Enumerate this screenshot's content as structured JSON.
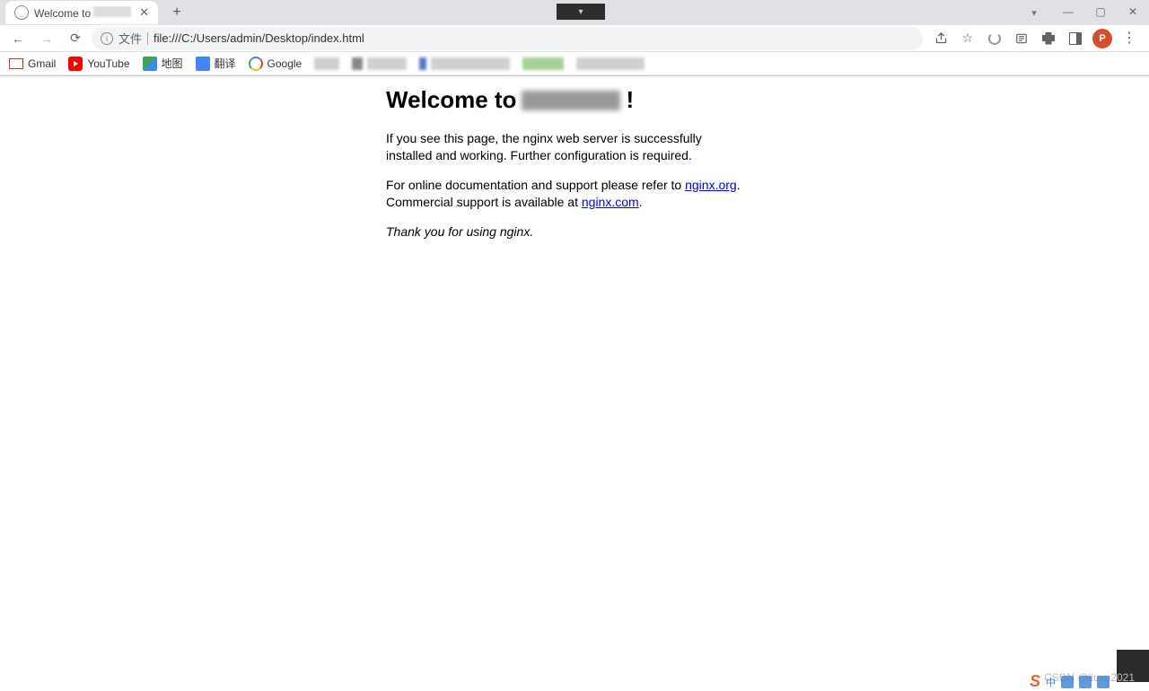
{
  "tab": {
    "title_prefix": "Welcome to"
  },
  "address": {
    "file_label": "文件",
    "url": "file:///C:/Users/admin/Desktop/index.html"
  },
  "bookmarks": {
    "gmail": "Gmail",
    "youtube": "YouTube",
    "maps": "地图",
    "translate": "翻译",
    "google": "Google"
  },
  "toolbar": {
    "avatar_initial": "P"
  },
  "page": {
    "heading_prefix": "Welcome to",
    "heading_suffix": "!",
    "para1": "If you see this page, the nginx web server is successfully installed and working. Further configuration is required.",
    "para2_a": "For online documentation and support please refer to ",
    "link_org": "nginx.org",
    "para2_b": ".",
    "para2_c": "Commercial support is available at ",
    "link_com": "nginx.com",
    "para2_d": ".",
    "thanks": "Thank you for using nginx."
  },
  "watermark": "CSDN @liuxp2021"
}
